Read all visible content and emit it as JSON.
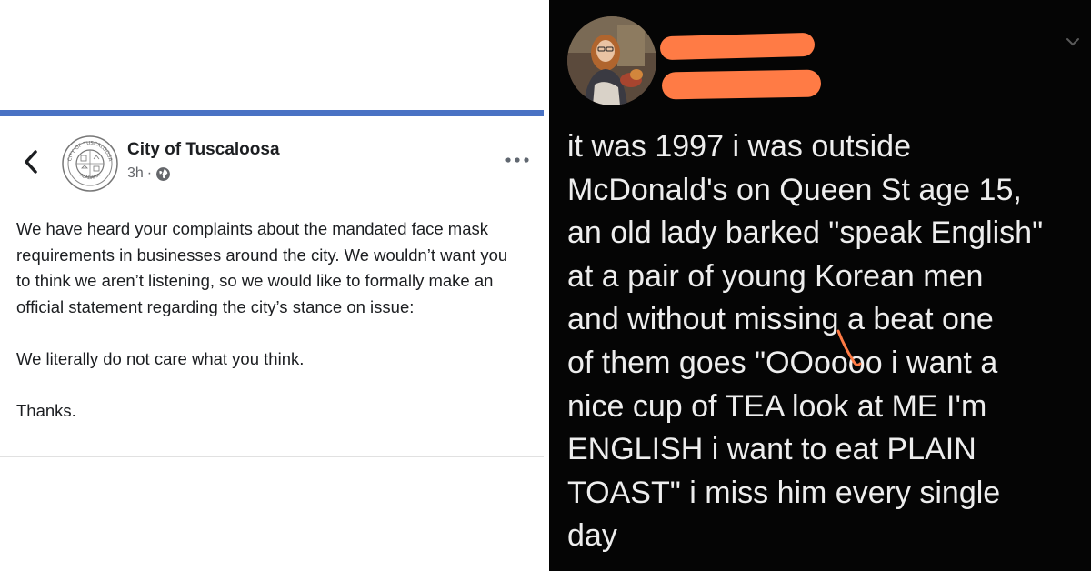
{
  "facebook_post": {
    "page_name": "City of Tuscaloosa",
    "time": "3h",
    "time_separator": "·",
    "seal_text_top": "CITY OF TUSCALOOSA",
    "seal_text_bottom": "ALABAMA",
    "paragraphs": [
      "We have heard your complaints about the mandated face mask requirements in businesses around the city. We wouldn’t want you to think we aren’t listening, so we would like to formally make an official statement regarding the city’s stance on issue:",
      "We literally do not care what you think.",
      "Thanks."
    ]
  },
  "tweet": {
    "lines": [
      "it was 1997 i was outside",
      "McDonald's on Queen St age 15,",
      "an old lady barked \"speak English\"",
      "at a pair of young Korean men",
      "and without missing a beat one",
      "of them goes \"OOoooo i want a",
      "nice cup of TEA look at ME I'm",
      "ENGLISH i want to eat PLAIN",
      "TOAST\" i miss him every single",
      "day"
    ]
  },
  "colors": {
    "facebook_rule": "#4a72c4",
    "tweet_background": "#050505",
    "tweet_text": "#ededed",
    "redaction": "#ff7b45"
  },
  "icons": {
    "back": "chevron-left-icon",
    "globe": "globe-icon",
    "more": "more-horizontal-icon",
    "tweet_menu": "chevron-down-icon"
  }
}
